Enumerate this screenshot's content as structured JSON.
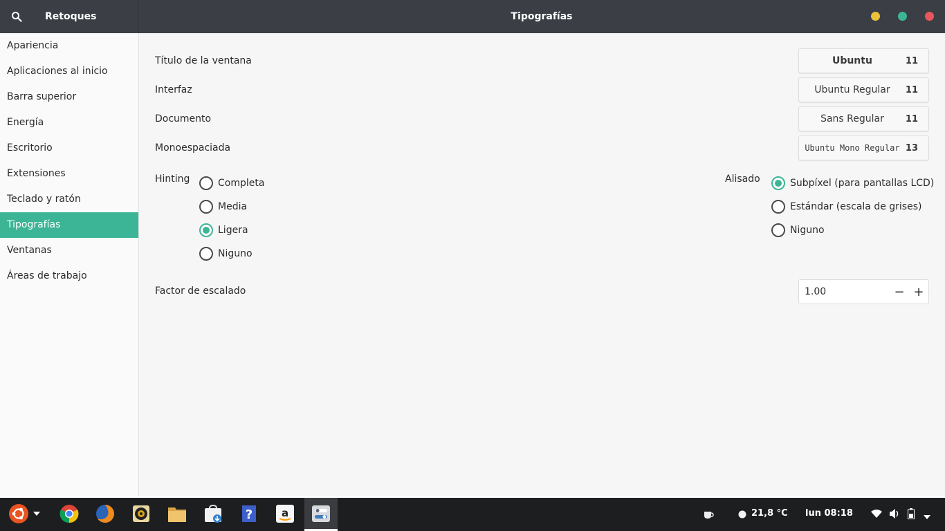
{
  "header": {
    "app_name": "Retoques",
    "page_title": "Tipografías",
    "colors": {
      "minimize": "#e7c23a",
      "maximize": "#3cb596",
      "close": "#e8575a"
    }
  },
  "sidebar": {
    "items": [
      {
        "label": "Apariencia"
      },
      {
        "label": "Aplicaciones al inicio"
      },
      {
        "label": "Barra superior"
      },
      {
        "label": "Energía"
      },
      {
        "label": "Escritorio"
      },
      {
        "label": "Extensiones"
      },
      {
        "label": "Teclado y ratón"
      },
      {
        "label": "Tipografías",
        "active": true
      },
      {
        "label": "Ventanas"
      },
      {
        "label": "Áreas de trabajo"
      }
    ]
  },
  "fonts": {
    "window_title": {
      "label": "Título de la ventana",
      "font": "Ubuntu",
      "size": "11"
    },
    "interface": {
      "label": "Interfaz",
      "font": "Ubuntu Regular",
      "size": "11"
    },
    "document": {
      "label": "Documento",
      "font": "Sans Regular",
      "size": "11"
    },
    "monospace": {
      "label": "Monoespaciada",
      "font": "Ubuntu Mono Regular",
      "size": "13"
    }
  },
  "hinting": {
    "label": "Hinting",
    "options": [
      "Completa",
      "Media",
      "Ligera",
      "Niguno"
    ],
    "selected": "Ligera"
  },
  "antialiasing": {
    "label": "Alisado",
    "options": [
      "Subpíxel (para pantallas LCD)",
      "Estándar (escala de grises)",
      "Niguno"
    ],
    "selected": "Subpíxel (para pantallas LCD)"
  },
  "scaling": {
    "label": "Factor de escalado",
    "value": "1.00",
    "decrement": "−",
    "increment": "+"
  },
  "taskbar": {
    "apps": [
      "ubuntu-icon",
      "chrome-icon",
      "firefox-icon",
      "rhythmbox-icon",
      "files-icon",
      "software-icon",
      "help-icon",
      "amazon-icon",
      "tweaks-icon"
    ],
    "weather": "21,8 °C",
    "clock": "lun 08:18"
  }
}
